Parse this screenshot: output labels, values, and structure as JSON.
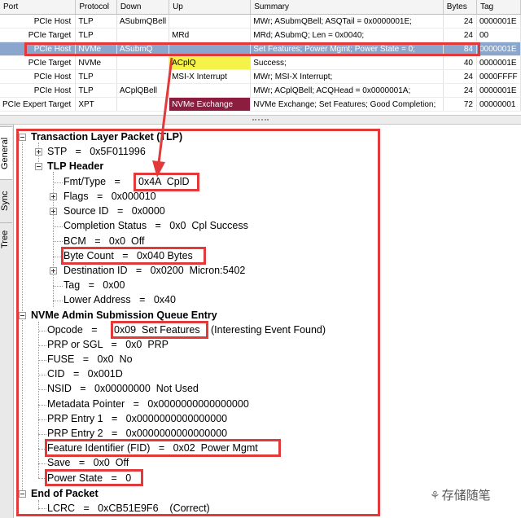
{
  "grid": {
    "columns": [
      "Port",
      "Protocol",
      "Down",
      "Up",
      "Summary",
      "Bytes",
      "Tag"
    ],
    "rows": [
      {
        "port": "PCIe Host",
        "protocol": "TLP",
        "down": "ASubmQBell",
        "up": "",
        "summary": "MWr; ASubmQBell; ASQTail = 0x0000001E;",
        "bytes": "24",
        "tag": "0000001E"
      },
      {
        "port": "PCIe Target",
        "protocol": "TLP",
        "down": "",
        "up": "MRd",
        "summary": "MRd; ASubmQ; Len = 0x0040;",
        "bytes": "24",
        "tag": "00"
      },
      {
        "port": "PCIe Host",
        "protocol": "NVMe",
        "down": "ASubmQ",
        "up": "",
        "summary": "Set Features; Power Mgmt; Power State = 0;",
        "bytes": "84",
        "tag": "0000001E"
      },
      {
        "port": "PCIe Target",
        "protocol": "NVMe",
        "down": "",
        "up": "ACplQ",
        "summary": "Success;",
        "bytes": "40",
        "tag": "0000001E"
      },
      {
        "port": "PCIe Host",
        "protocol": "TLP",
        "down": "",
        "up": "MSI-X Interrupt",
        "summary": "MWr; MSI-X Interrupt;",
        "bytes": "24",
        "tag": "0000FFFF"
      },
      {
        "port": "PCIe Host",
        "protocol": "TLP",
        "down": "ACplQBell",
        "up": "",
        "summary": "MWr; ACplQBell; ACQHead = 0x0000001A;",
        "bytes": "24",
        "tag": "0000001E"
      },
      {
        "port": "PCIe Expert Target",
        "protocol": "XPT",
        "down": "",
        "up": "NVMe Exchange",
        "summary": "NVMe Exchange; Set Features; Good Completion;",
        "bytes": "72",
        "tag": "00000001"
      }
    ],
    "highlight_colors": {
      "selected_row": "#8aa6cd",
      "acplq": "#f5f24a",
      "nvme_exchange": "#8c1d40",
      "annotation": "#e23a3a"
    }
  },
  "tabs": {
    "general": "General",
    "sync": "Sync",
    "tree": "Tree"
  },
  "tree": {
    "tlp_title": "Transaction Layer Packet (TLP)",
    "stp": "STP   =   0x5F011996",
    "tlp_header": "TLP Header",
    "fmt_label": "Fmt/Type   =",
    "fmt_value": "0x4A  CplD",
    "flags": "Flags   =   0x000010",
    "source_id": "Source ID   =   0x0000",
    "completion_status": "Completion Status   =   0x0  Cpl Success",
    "bcm": "BCM   =   0x0  Off",
    "byte_count": "Byte Count   =   0x040 Bytes",
    "destination_id": "Destination ID   =   0x0200  Micron:5402",
    "tag": "Tag   =   0x00",
    "lower_address": "Lower Address   =   0x40",
    "nvme_title": "NVMe Admin Submission Queue Entry",
    "opcode_label": "Opcode   =",
    "opcode_value": "0x09  Set Features",
    "opcode_note": "(Interesting Event Found)",
    "prp_or_sgl": "PRP or SGL   =   0x0  PRP",
    "fuse": "FUSE   =   0x0  No",
    "cid": "CID   =   0x001D",
    "nsid": "NSID   =   0x00000000  Not Used",
    "metadata_pointer": "Metadata Pointer   =   0x0000000000000000",
    "prp_entry_1": "PRP Entry 1   =   0x0000000000000000",
    "prp_entry_2": "PRP Entry 2   =   0x0000000000000000",
    "feature_identifier": "Feature Identifier (FID)   =   0x02  Power Mgmt",
    "save": "Save   =   0x0  Off",
    "power_state": "Power State   =   0",
    "end_title": "End of Packet",
    "lcrc": "LCRC   =   0xCB51E9F6    (Correct)"
  },
  "watermark": "存储随笔"
}
